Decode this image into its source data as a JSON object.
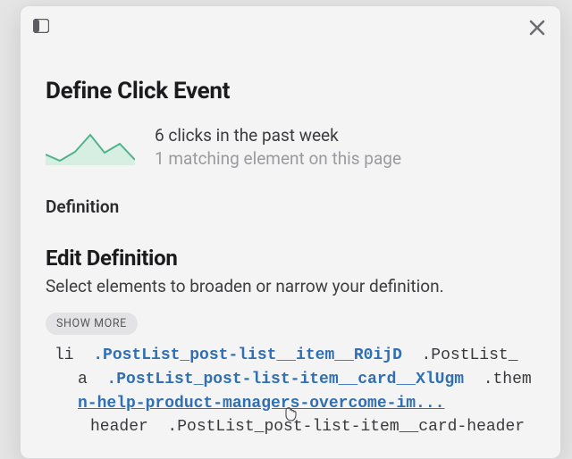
{
  "header": {
    "title": "Define Click Event"
  },
  "stats": {
    "primary": "6 clicks in the past week",
    "secondary": "1 matching element on this page"
  },
  "sections": {
    "definition_label": "Definition",
    "edit_title": "Edit Definition",
    "edit_desc": "Select elements to broaden or narrow your definition.",
    "show_more": "SHOW MORE"
  },
  "selector_tree": {
    "r1_tag": "li",
    "r1_strong": ".PostList_post-list__item__R0ijD",
    "r1_tail": ".PostList_",
    "r2_tag": "a",
    "r2_strong": ".PostList_post-list-item__card__XlUgm",
    "r2_tail": ".them",
    "r3_link": "n-help-product-managers-overcome-im...",
    "r4_tag": "header",
    "r4_tail": ".PostList_post-list-item__card-header"
  },
  "chart_data": {
    "type": "line",
    "values": [
      1.2,
      0.4,
      1.0,
      2.2,
      1.0,
      1.6,
      0.4
    ],
    "ylim": [
      0,
      2.5
    ],
    "title": "",
    "xlabel": "",
    "ylabel": ""
  }
}
